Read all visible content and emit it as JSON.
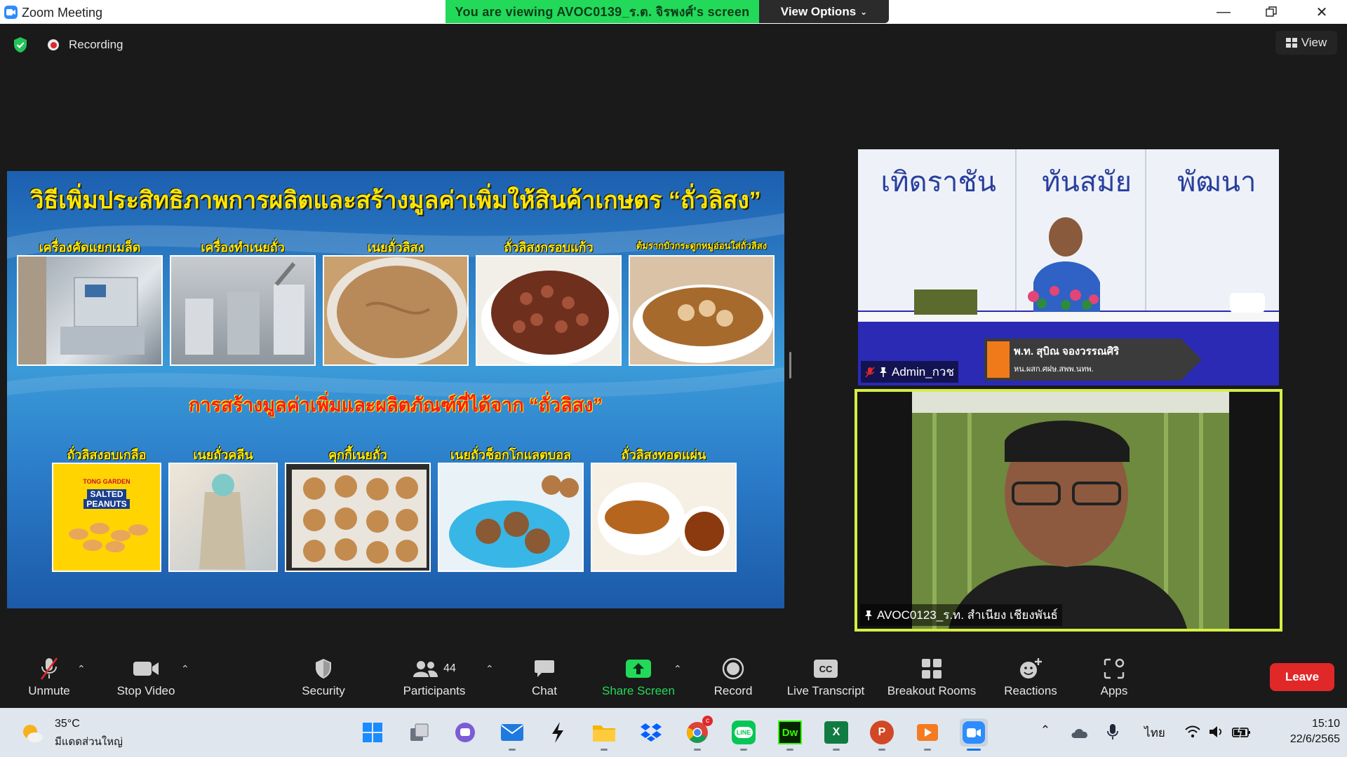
{
  "window": {
    "app_title": "Zoom Meeting",
    "viewing_banner": "You are viewing AVOC0139_ร.ต. จิรพงศ์'s screen",
    "view_options_label": "View Options",
    "recording_label": "Recording",
    "view_label": "View"
  },
  "slide": {
    "title": "วิธีเพิ่มประสิทธิภาพการผลิตและสร้างมูลค่าเพิ่มให้สินค้าเกษตร “ถั่วลิสง”",
    "row1_captions": [
      "เครื่องคัดแยกเมล็ด",
      "เครื่องทำเนยถั่ว",
      "เนยถั่วลิสง",
      "ถั่วลิสงกรอบแก้ว",
      "ต้มรากบัวกระดูกหมูอ่อนใส่ถั่วลิสง"
    ],
    "subtitle": "การสร้างมูลค่าเพิ่มและผลิตภัณฑ์ที่ได้จาก “ถั่วลิสง”",
    "row2_captions": [
      "ถั่วลิสงอบเกลือ",
      "เนยถั่วคลีน",
      "คุกกี้เนยถั่ว",
      "เนยถั่วช็อกโกแลตบอล",
      "ถั่วลิสงทอดแผ่น"
    ],
    "product_pack_text": [
      "TONG GARDEN",
      "SALTED",
      "PEANUTS"
    ]
  },
  "tiles": {
    "tile1": {
      "banner_words": [
        "เทิดราชัน",
        "ทันสมัย",
        "พัฒนา"
      ],
      "nameplate_line1": "พ.ท. สุบิณ  จองวรรณศิริ",
      "nameplate_line2": "หน.ผสก.ศฝษ.สพพ.นทพ.",
      "name": "Admin_กวช"
    },
    "tile2": {
      "name": "AVOC0123_ร.ท. สำเนียง เชียงพันธ์"
    }
  },
  "toolbar": {
    "unmute": "Unmute",
    "stop_video": "Stop Video",
    "security": "Security",
    "participants": "Participants",
    "participants_count": "44",
    "chat": "Chat",
    "share_screen": "Share Screen",
    "record": "Record",
    "live_transcript": "Live Transcript",
    "breakout_rooms": "Breakout Rooms",
    "reactions": "Reactions",
    "apps": "Apps",
    "leave": "Leave",
    "cc_text": "CC"
  },
  "taskbar": {
    "weather_temp": "35°C",
    "weather_desc": "มีแดดส่วนใหญ่",
    "language": "ไทย",
    "time": "15:10",
    "date": "22/6/2565",
    "chrome_badge": "c",
    "dw_label": "Dw",
    "excel_label": "X",
    "ppt_label": "P",
    "line_label": "LINE"
  },
  "colors": {
    "share_green": "#23d959",
    "leave_red": "#e02828",
    "active_speaker": "#d6ee44",
    "zoom_blue": "#2d8cff"
  }
}
